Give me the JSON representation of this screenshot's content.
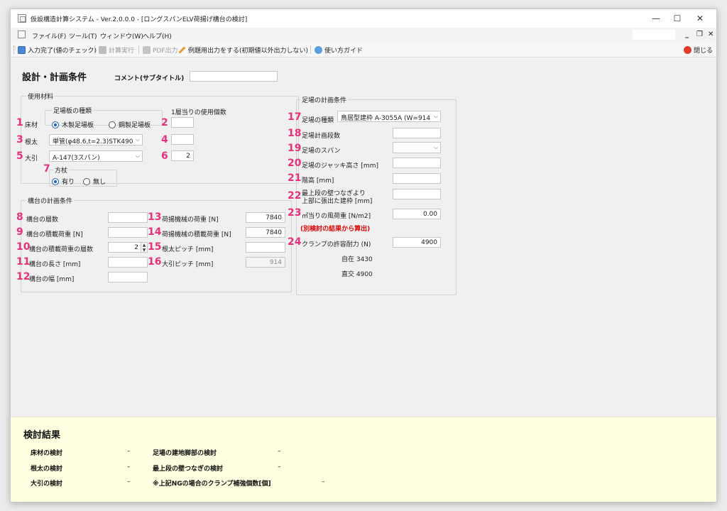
{
  "window": {
    "title": "仮設構造計算システム - Ver.2.0.0.0 - [ロングスパンELV荷揚げ構台の検討]",
    "controls": {
      "minimize": "—",
      "maximize": "☐",
      "close": "✕"
    }
  },
  "menu": {
    "items": [
      "ファイル(F)",
      "ツール(T)",
      "ウィンドウ(W)",
      "ヘルプ(H)"
    ],
    "mdi_controls": {
      "minimize": "_",
      "restore": "❐",
      "close": "✕"
    }
  },
  "toolbar": {
    "input_done": "入力完了(値のチェック)",
    "calc": "計算実行",
    "pdf": "PDF出力",
    "example_output": "例題用出力をする(初期値以外出力しない)",
    "guide": "使い方ガイド",
    "close": "閉じる"
  },
  "page": {
    "title": "設計・計画条件",
    "comment_label": "コメント(サブタイトル)",
    "comment_value": ""
  },
  "materials": {
    "group_title": "使用材料",
    "plank_type_title": "足場板の種類",
    "usage_title": "1層当りの使用個数",
    "floor_label": "床材",
    "plank_options": [
      "木製足場板",
      "鋼製足場板"
    ],
    "plank_selected": 0,
    "neda_label": "根太",
    "neda_value": "単管(φ48.6,t=2.3)STK490",
    "obiki_label": "大引",
    "obiki_value": "A-147(3スパン)",
    "usage_2": "",
    "usage_4": "",
    "usage_6": "2",
    "houzue_title": "方杖",
    "houzue_options": [
      "有り",
      "無し"
    ],
    "houzue_selected": 0
  },
  "stage": {
    "group_title": "構台の計画条件",
    "layers_label": "構台の層数",
    "layers_value": "",
    "load_label": "構台の積載荷重 [N]",
    "load_value": "",
    "load_layers_label": "構台の積載荷重の層数",
    "load_layers_value": "2",
    "length_label": "構台の長さ [mm]",
    "length_value": "",
    "width_label": "構台の幅 [mm]",
    "width_value": "",
    "machine_load_label": "荷揚機械の荷重 [N]",
    "machine_load_value": "7840",
    "machine_payload_label": "荷揚機械の積載荷重 [N]",
    "machine_payload_value": "7840",
    "neda_pitch_label": "根太ピッチ [mm]",
    "neda_pitch_value": "",
    "obiki_pitch_label": "大引ピッチ [mm]",
    "obiki_pitch_value": "914"
  },
  "scaffold": {
    "group_title": "足場の計画条件",
    "type_label": "足場の種類",
    "type_value": "鳥居型建枠 A-3055A (W=914",
    "stages_label": "足場計画段数",
    "stages_value": "",
    "span_label": "足場のスパン",
    "span_value": "",
    "jack_label": "足場のジャッキ高さ [mm]",
    "jack_value": "",
    "floor_height_label": "階高 [mm]",
    "floor_height_value": "",
    "top_line1": "最上段の壁つなぎより",
    "top_line2": "上部に張出た建枠 [mm]",
    "top_value": "",
    "wind_label": "㎡当りの風荷重 [N/m2]",
    "wind_value": "0.00",
    "wind_note": "(別検討の結果から算出)",
    "clamp_label": "クランプの許容耐力 (N)",
    "clamp_value": "4900",
    "free_text": "自在 3430",
    "orth_text": "直交 4900"
  },
  "badges": [
    "1",
    "2",
    "3",
    "4",
    "5",
    "6",
    "7",
    "8",
    "9",
    "10",
    "11",
    "12",
    "13",
    "14",
    "15",
    "16",
    "17",
    "18",
    "19",
    "20",
    "21",
    "22",
    "23",
    "24"
  ],
  "results": {
    "title": "検討結果",
    "floor_check": "床材の検討",
    "floor_check_val": "–",
    "neda_check": "根太の検討",
    "neda_check_val": "–",
    "obiki_check": "大引の検討",
    "obiki_check_val": "–",
    "base_check": "足場の建地脚部の検討",
    "base_check_val": "–",
    "tie_check": "最上段の壁つなぎの検討",
    "tie_check_val": "–",
    "clamp_check": "※上記NGの場合のクランプ補強個数[個]",
    "clamp_check_val": "–"
  },
  "colors": {
    "badge": "#e8317a",
    "note": "#e00000",
    "results_bg": "#ffffe1",
    "radio_on": "#1a5fb4"
  }
}
